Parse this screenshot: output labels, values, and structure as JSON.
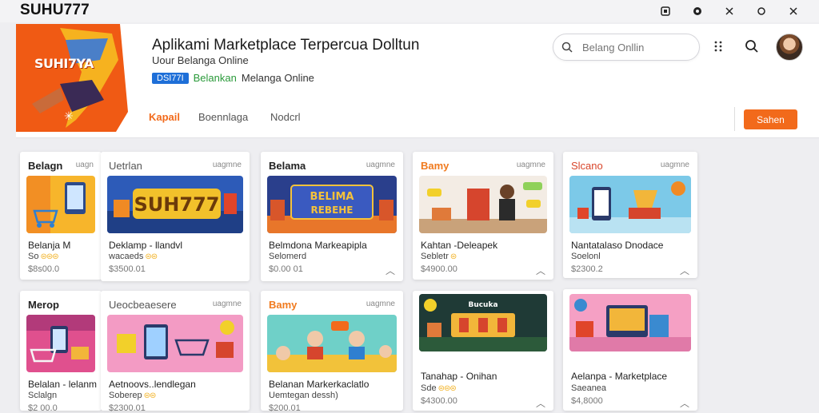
{
  "window": {
    "title": "SUHU777",
    "controls": [
      "screen-icon",
      "settings-icon",
      "minimize-icon",
      "restore-icon",
      "close-icon"
    ]
  },
  "header": {
    "banner_logo": "SUHI7YA",
    "title": "Aplikami Marketplace Terpercua Dolltun",
    "subtitle": "Uour Belanga Online",
    "badge": "DSI77I",
    "tag_green": "Belankan",
    "tag_rest": "Melanga Online",
    "search_placeholder": "Belang Onllin",
    "icons": [
      "more-icon",
      "search-icon",
      "avatar"
    ]
  },
  "nav": {
    "tabs": [
      {
        "label": "Kapail",
        "active": true
      },
      {
        "label": "Boennlaga",
        "active": false
      },
      {
        "label": "Nodcrl",
        "active": false
      }
    ],
    "action_button": "Sahen"
  },
  "cards": [
    {
      "category": "Belagn",
      "tag": "uagn",
      "title": "Belanja M",
      "subtitle": "So",
      "stars": "⊜⊜⊜",
      "price": "$8s00.0",
      "image": "cart-phone"
    },
    {
      "category": "Uetrlan",
      "tag": "uagmne",
      "title": "Deklamp - llandvl",
      "subtitle": "wacaeds",
      "stars": "⊜⊜",
      "price": "$3500.01",
      "image": "suh777-banner"
    },
    {
      "category": "Belama",
      "tag": "uagmne",
      "title": "Belmdona Markeapipla",
      "subtitle": "Selomerd",
      "stars": "",
      "price": "$0.00 01",
      "image": "belima-stage"
    },
    {
      "category": "Bamy",
      "tag": "uagmne",
      "title": "Kahtan -Deleapek",
      "subtitle": "Sebletr",
      "stars": "⊜",
      "price": "$4900.00",
      "image": "shop-person"
    },
    {
      "category": "Slcano",
      "tag": "uagmne",
      "title": "Nantatalaso Dnodace",
      "subtitle": "Soelonl",
      "stars": "",
      "price": "$2300.2",
      "image": "phone-shop"
    },
    {
      "category": "Merop",
      "tag": "",
      "title": "Belalan - lelanm",
      "subtitle": "Sclalgn",
      "stars": "",
      "price": "$2 00.0",
      "image": "pink-carts"
    },
    {
      "category": "Ueocbeaesere",
      "tag": "uagmne",
      "title": "Aetnoovs..lendlegan",
      "subtitle": "Soberep",
      "stars": "⊜⊜",
      "price": "$2300.01",
      "image": "pink-tablets"
    },
    {
      "category": "Bamy",
      "tag": "uagmne",
      "title": "Belanan Markerkaclatlo",
      "subtitle": "Uemtegan dessh)",
      "stars": "",
      "price": "$200.01",
      "image": "cartoon-kids"
    },
    {
      "category": "",
      "tag": "",
      "title": "Tanahap - Onihan",
      "subtitle": "Sde",
      "stars": "⊜⊜⊜",
      "price": "$4300.00",
      "image": "dark-shop"
    },
    {
      "category": "",
      "tag": "",
      "title": "Aelanpa - Marketplace",
      "subtitle": "Saeanea",
      "stars": "",
      "price": "$4,8000",
      "image": "pink-store"
    }
  ],
  "colors": {
    "accent": "#f26a1b",
    "badge_blue": "#1e6fd8",
    "tag_green": "#2a9a3a",
    "star": "#f2b01e"
  }
}
